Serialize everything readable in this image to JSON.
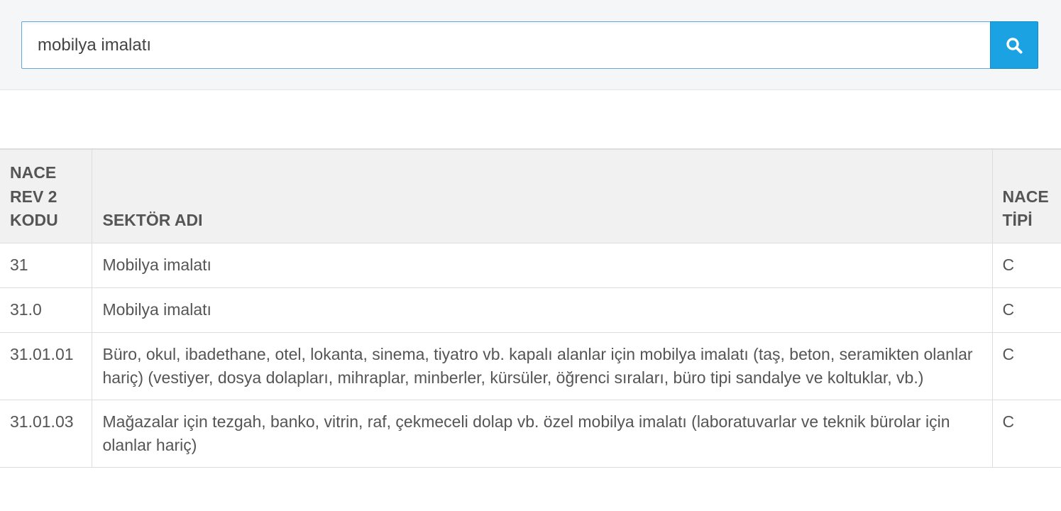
{
  "search": {
    "value": "mobilya imalatı",
    "button_icon": "search-icon"
  },
  "colors": {
    "accent": "#1aa2e2",
    "header_bg": "#f1f1f1",
    "border": "#dddddd",
    "search_border": "#6aa6d8"
  },
  "table": {
    "headers": {
      "code": "NACE REV 2 KODU",
      "name": "SEKTÖR ADI",
      "type": "NACE TİPİ"
    },
    "rows": [
      {
        "code": "31",
        "name": "Mobilya imalatı",
        "type": "C"
      },
      {
        "code": "31.0",
        "name": "Mobilya imalatı",
        "type": "C"
      },
      {
        "code": "31.01.01",
        "name": "Büro, okul, ibadethane, otel, lokanta, sinema, tiyatro vb. kapalı alanlar için mobilya imalatı (taş, beton, seramikten olanlar hariç) (vestiyer, dosya dolapları, mihraplar, minberler, kürsüler, öğrenci sıraları, büro tipi sandalye ve koltuklar, vb.)",
        "type": "C"
      },
      {
        "code": "31.01.03",
        "name": "Mağazalar için tezgah, banko, vitrin, raf, çekmeceli dolap vb. özel mobilya imalatı (laboratuvarlar ve teknik bürolar için olanlar hariç)",
        "type": "C"
      }
    ]
  }
}
